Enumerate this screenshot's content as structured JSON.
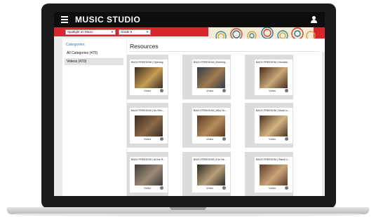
{
  "app": {
    "title": "MUSIC STUDIO"
  },
  "filters": {
    "program": "Spotlight on Music",
    "grade": "Grade 5"
  },
  "sidebar": {
    "heading": "Categories",
    "items": [
      {
        "label": "All Categories (470)",
        "active": false
      },
      {
        "label": "Videos (470)",
        "active": true
      }
    ]
  },
  "main": {
    "heading": "Resources",
    "cards": [
      {
        "title": "BACH FREEDOM | Opening",
        "type": "Video",
        "thumb": [
          "#3a2e20",
          "#c79b55"
        ]
      },
      {
        "title": "BACH FREEDOM | Entering...",
        "type": "Video",
        "thumb": [
          "#2f3e4a",
          "#a07a4e"
        ]
      },
      {
        "title": "BACH FREEDOM | Hornbla...",
        "type": "Video",
        "thumb": [
          "#4a2c1e",
          "#c9a879"
        ]
      },
      {
        "title": "BACH FREEDOM | No Res...",
        "type": "Video",
        "thumb": [
          "#3b2b22",
          "#8c6a48"
        ]
      },
      {
        "title": "BACH FREEDOM | Why No...",
        "type": "Video",
        "thumb": [
          "#5a3a25",
          "#b58b5a"
        ]
      },
      {
        "title": "BACH FREEDOM | Music is...",
        "type": "Video",
        "thumb": [
          "#4a3422",
          "#d6b583"
        ]
      },
      {
        "title": "BACH FREEDOM | All the R...",
        "type": "Video",
        "thumb": [
          "#3d3a3a",
          "#9b8a77"
        ]
      },
      {
        "title": "BACH FREEDOM | It is Far...",
        "type": "Video",
        "thumb": [
          "#2d2a24",
          "#b9a07a"
        ]
      },
      {
        "title": "BACH FREEDOM | Stand U...",
        "type": "Video",
        "thumb": [
          "#5b3c2b",
          "#caa377"
        ]
      }
    ]
  },
  "colors": {
    "accent_red": "#d8262d",
    "topbar": "#0d0d0d",
    "category_link": "#2c7bb0"
  }
}
